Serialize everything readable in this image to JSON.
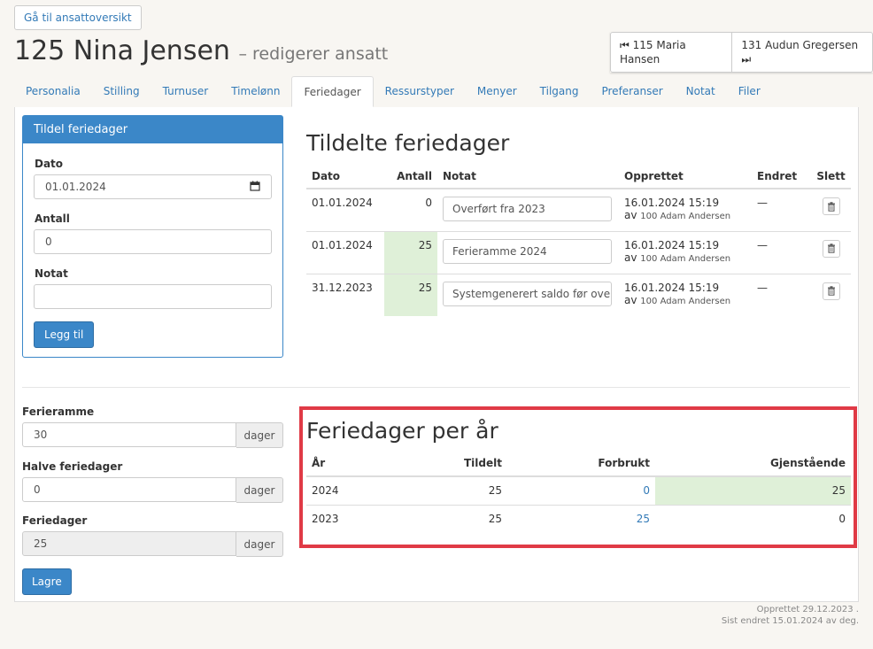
{
  "header": {
    "back_label": "Gå til ansattoversikt",
    "title": "125 Nina Jensen",
    "subtitle": "– redigerer ansatt",
    "prev_employee": "115 Maria Hansen",
    "next_employee": "131 Audun Gregersen"
  },
  "tabs": [
    {
      "label": "Personalia",
      "active": false
    },
    {
      "label": "Stilling",
      "active": false
    },
    {
      "label": "Turnuser",
      "active": false
    },
    {
      "label": "Timelønn",
      "active": false
    },
    {
      "label": "Feriedager",
      "active": true
    },
    {
      "label": "Ressurstyper",
      "active": false
    },
    {
      "label": "Menyer",
      "active": false
    },
    {
      "label": "Tilgang",
      "active": false
    },
    {
      "label": "Preferanser",
      "active": false
    },
    {
      "label": "Notat",
      "active": false
    },
    {
      "label": "Filer",
      "active": false
    }
  ],
  "assign_form": {
    "heading": "Tildel feriedager",
    "date_label": "Dato",
    "date_value": "01.01.2024",
    "count_label": "Antall",
    "count_value": "0",
    "note_label": "Notat",
    "note_value": "",
    "submit_label": "Legg til"
  },
  "assigned": {
    "heading": "Tildelte feriedager",
    "columns": {
      "date": "Dato",
      "count": "Antall",
      "note": "Notat",
      "created": "Opprettet",
      "changed": "Endret",
      "delete": "Slett"
    },
    "rows": [
      {
        "date": "01.01.2024",
        "count": "0",
        "note": "Overført fra 2023",
        "created": "16.01.2024 15:19",
        "by_prefix": "av",
        "by": "100 Adam Andersen",
        "changed": "—",
        "highlight": false
      },
      {
        "date": "01.01.2024",
        "count": "25",
        "note": "Ferieramme 2024",
        "created": "16.01.2024 15:19",
        "by_prefix": "av",
        "by": "100 Adam Andersen",
        "changed": "—",
        "highlight": true
      },
      {
        "date": "31.12.2023",
        "count": "25",
        "note": "Systemgenerert saldo før overføring",
        "created": "16.01.2024 15:19",
        "by_prefix": "av",
        "by": "100 Adam Andersen",
        "changed": "—",
        "highlight": true
      }
    ]
  },
  "settings": {
    "frame_label": "Ferieramme",
    "frame_value": "30",
    "half_label": "Halve feriedager",
    "half_value": "0",
    "days_label": "Feriedager",
    "days_value": "25",
    "unit": "dager",
    "save_label": "Lagre"
  },
  "per_year": {
    "heading": "Feriedager per år",
    "columns": {
      "year": "År",
      "assigned": "Tildelt",
      "used": "Forbrukt",
      "remaining": "Gjenstående"
    },
    "rows": [
      {
        "year": "2024",
        "assigned": "25",
        "used": "0",
        "remaining": "25",
        "highlight": true
      },
      {
        "year": "2023",
        "assigned": "25",
        "used": "25",
        "remaining": "0",
        "highlight": false
      }
    ]
  },
  "footer": {
    "created": "Opprettet 29.12.2023 .",
    "changed": "Sist endret 15.01.2024 av deg."
  },
  "colors": {
    "primary": "#3b87c8",
    "link": "#337ab7",
    "success_bg": "#dff0d8",
    "highlight_border": "#e03a46"
  }
}
